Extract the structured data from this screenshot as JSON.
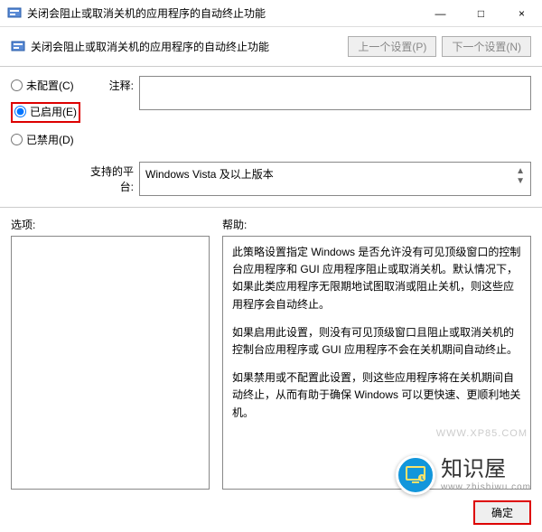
{
  "window": {
    "title": "关闭会阻止或取消关机的应用程序的自动终止功能",
    "minimize": "—",
    "maximize": "□",
    "close": "×"
  },
  "header": {
    "desc": "关闭会阻止或取消关机的应用程序的自动终止功能",
    "prev": "上一个设置(P)",
    "next": "下一个设置(N)"
  },
  "radios": {
    "not_configured": "未配置(C)",
    "enabled": "已启用(E)",
    "disabled": "已禁用(D)"
  },
  "labels": {
    "comment": "注释:",
    "supported": "支持的平台:",
    "options": "选项:",
    "help": "帮助:"
  },
  "fields": {
    "comment_value": "",
    "supported_value": "Windows Vista 及以上版本"
  },
  "help": {
    "p1": "此策略设置指定 Windows 是否允许没有可见顶级窗口的控制台应用程序和 GUI 应用程序阻止或取消关机。默认情况下，如果此类应用程序无限期地试图取消或阻止关机，则这些应用程序会自动终止。",
    "p2": "如果启用此设置，则没有可见顶级窗口且阻止或取消关机的控制台应用程序或 GUI 应用程序不会在关机期间自动终止。",
    "p3": "如果禁用或不配置此设置，则这些应用程序将在关机期间自动终止，从而有助于确保 Windows 可以更快速、更顺利地关机。"
  },
  "footer": {
    "ok": "确定"
  },
  "watermark": "WWW.XP85.COM",
  "brand": {
    "name": "知识屋",
    "url": "www.zhishiwu.com"
  }
}
